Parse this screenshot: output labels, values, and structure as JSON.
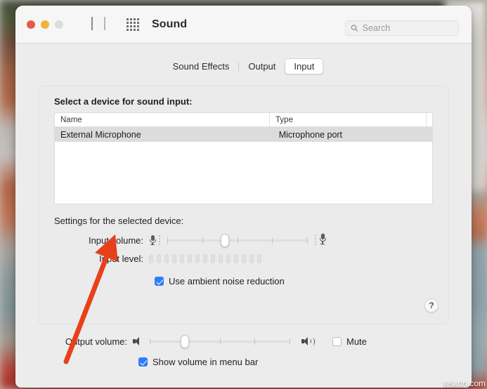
{
  "window": {
    "title": "Sound",
    "traffic_lights": [
      "close",
      "minimize",
      "zoom"
    ],
    "nav": {
      "back": "back-chevron",
      "forward": "forward-chevron"
    },
    "grid_icon": "show-all-icon"
  },
  "search": {
    "placeholder": "Search",
    "value": "",
    "icon": "search-icon"
  },
  "tabs": [
    {
      "label": "Sound Effects",
      "selected": false
    },
    {
      "label": "Output",
      "selected": false
    },
    {
      "label": "Input",
      "selected": true
    }
  ],
  "device_section": {
    "label": "Select a device for sound input:",
    "columns": [
      "Name",
      "Type",
      ""
    ],
    "rows": [
      {
        "name": "External Microphone",
        "type": "Microphone port",
        "selected": true
      }
    ]
  },
  "settings_section": {
    "label": "Settings for the selected device:",
    "input_volume": {
      "label": "Input volume:",
      "value_percent": 41,
      "min_icon": "microphone-small-icon",
      "max_icon": "microphone-large-icon",
      "ticks": 5
    },
    "input_level": {
      "label": "Input level:",
      "segments_total": 15,
      "segments_active": 0
    },
    "ambient_noise": {
      "label": "Use ambient noise reduction",
      "checked": true
    },
    "help": {
      "label": "?",
      "icon": "help-icon"
    }
  },
  "output_section": {
    "output_volume": {
      "label": "Output volume:",
      "value_percent": 25,
      "min_icon": "speaker-mute-icon",
      "max_icon": "speaker-loud-icon",
      "ticks": 5
    },
    "mute": {
      "label": "Mute",
      "checked": false
    },
    "show_volume": {
      "label": "Show volume in menu bar",
      "checked": true
    }
  },
  "annotation": {
    "arrow_color": "#e8401b",
    "description": "red-arrow-pointing-to-input-volume"
  },
  "watermark": {
    "text": "wsxdn.com"
  }
}
